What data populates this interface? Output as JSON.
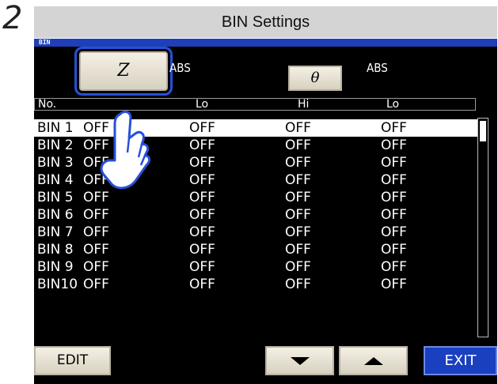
{
  "step_number": "2",
  "title": "BIN Settings",
  "screen_tag": "BIN",
  "param1": {
    "button": "Z",
    "mode": "ABS"
  },
  "param2": {
    "button": "θ",
    "mode": "ABS"
  },
  "columns": [
    "No.",
    "Lo",
    "Hi",
    "Lo"
  ],
  "rows": [
    {
      "no": "BIN 1",
      "v1": "OFF",
      "v2": "OFF",
      "v3": "OFF",
      "v4": "OFF"
    },
    {
      "no": "BIN 2",
      "v1": "OFF",
      "v2": "OFF",
      "v3": "OFF",
      "v4": "OFF"
    },
    {
      "no": "BIN 3",
      "v1": "OFF",
      "v2": "OFF",
      "v3": "OFF",
      "v4": "OFF"
    },
    {
      "no": "BIN 4",
      "v1": "OFF",
      "v2": "OFF",
      "v3": "OFF",
      "v4": "OFF"
    },
    {
      "no": "BIN 5",
      "v1": "OFF",
      "v2": "OFF",
      "v3": "OFF",
      "v4": "OFF"
    },
    {
      "no": "BIN 6",
      "v1": "OFF",
      "v2": "OFF",
      "v3": "OFF",
      "v4": "OFF"
    },
    {
      "no": "BIN 7",
      "v1": "OFF",
      "v2": "OFF",
      "v3": "OFF",
      "v4": "OFF"
    },
    {
      "no": "BIN 8",
      "v1": "OFF",
      "v2": "OFF",
      "v3": "OFF",
      "v4": "OFF"
    },
    {
      "no": "BIN 9",
      "v1": "OFF",
      "v2": "OFF",
      "v3": "OFF",
      "v4": "OFF"
    },
    {
      "no": "BIN10",
      "v1": "OFF",
      "v2": "OFF",
      "v3": "OFF",
      "v4": "OFF"
    }
  ],
  "buttons": {
    "edit": "EDIT",
    "exit": "EXIT"
  },
  "colors": {
    "accent": "#1a3fbf",
    "highlight": "#2850d8",
    "screen_bg": "#000000"
  }
}
